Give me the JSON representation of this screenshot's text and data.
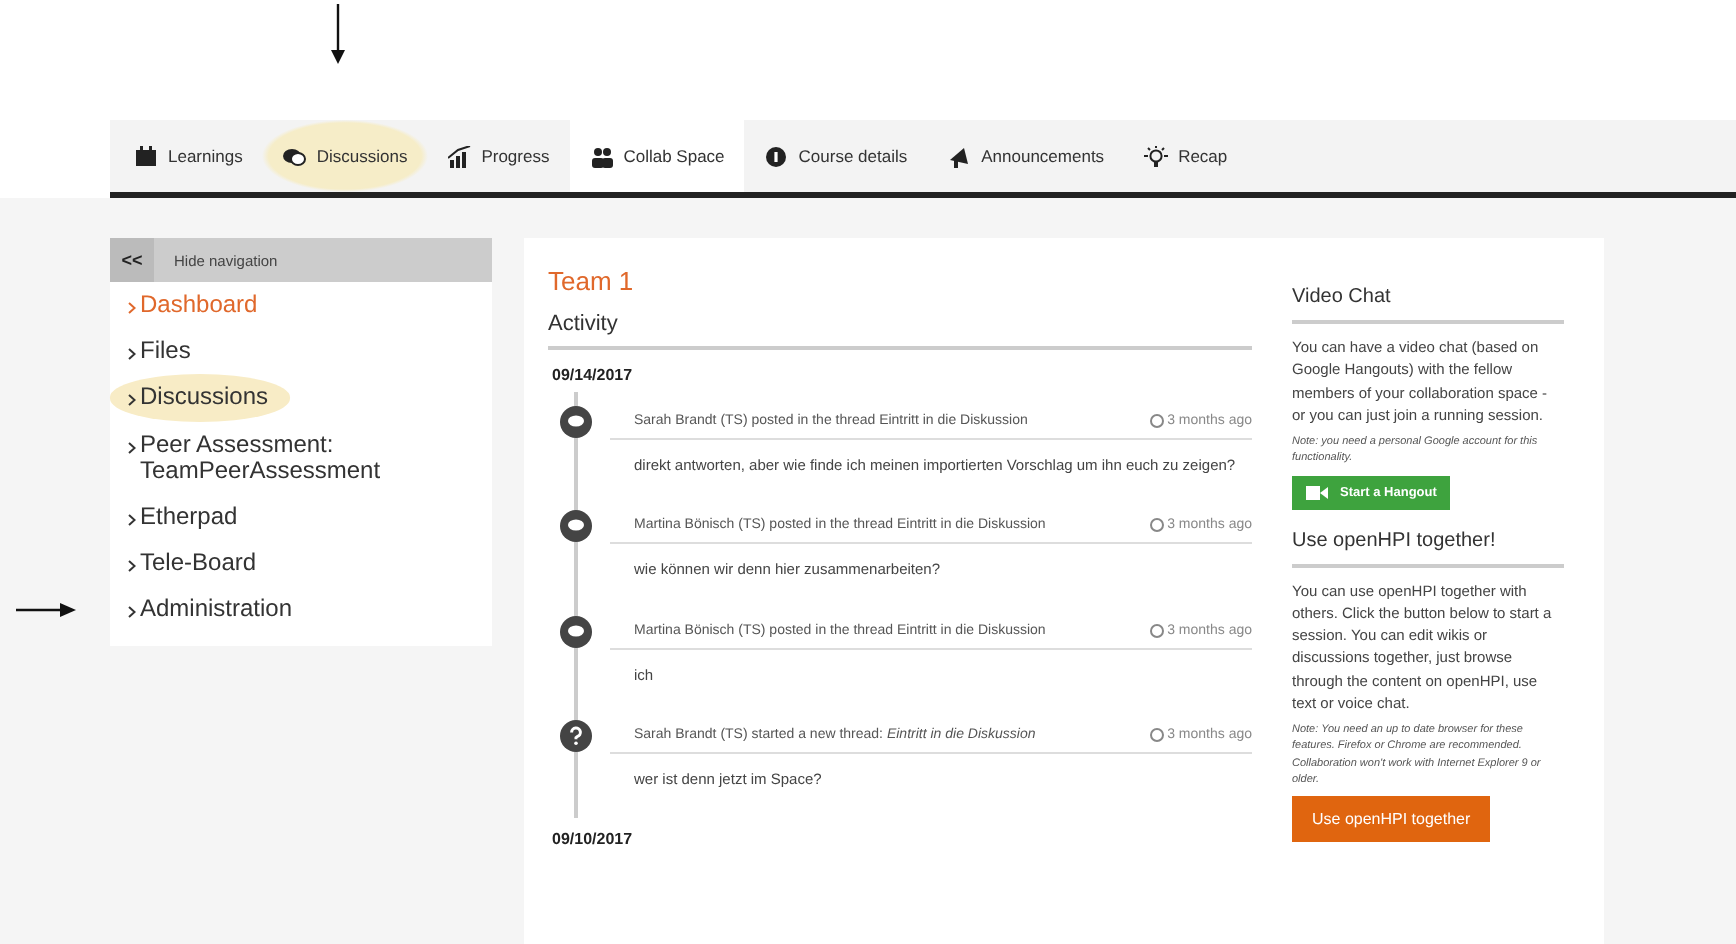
{
  "tabs": [
    {
      "label": "Learnings",
      "selected": false,
      "highlighted": false
    },
    {
      "label": "Discussions",
      "selected": false,
      "highlighted": true
    },
    {
      "label": "Progress",
      "selected": false,
      "highlighted": false
    },
    {
      "label": "Collab Space",
      "selected": true,
      "highlighted": false
    },
    {
      "label": "Course details",
      "selected": false,
      "highlighted": false
    },
    {
      "label": "Announcements",
      "selected": false,
      "highlighted": false
    },
    {
      "label": "Recap",
      "selected": false,
      "highlighted": false
    }
  ],
  "sidebar": {
    "toggle": "<<",
    "hide_label": "Hide navigation",
    "items": [
      {
        "label": "Dashboard",
        "selected": true,
        "highlighted": false
      },
      {
        "label": "Files",
        "selected": false,
        "highlighted": false
      },
      {
        "label": "Discussions",
        "selected": false,
        "highlighted": true
      },
      {
        "label": "Peer Assessment: TeamPeerAssessment",
        "selected": false,
        "highlighted": false
      },
      {
        "label": "Etherpad",
        "selected": false,
        "highlighted": false
      },
      {
        "label": "Tele-Board",
        "selected": false,
        "highlighted": false
      },
      {
        "label": "Administration",
        "selected": false,
        "highlighted": false
      }
    ]
  },
  "main": {
    "title": "Team 1",
    "section": "Activity",
    "groups": [
      {
        "date": "09/14/2017",
        "items": [
          {
            "kind": "post",
            "headline": "Sarah Brandt (TS) posted in the thread Eintritt in die Diskussion",
            "time": "3 months ago",
            "body": "direkt antworten, aber wie finde ich meinen importierten Vorschlag um ihn euch zu zeigen?"
          },
          {
            "kind": "post",
            "headline": "Martina Bönisch (TS) posted in the thread Eintritt in die Diskussion",
            "time": "3 months ago",
            "body": "wie können wir denn hier zusammenarbeiten?"
          },
          {
            "kind": "post",
            "headline": "Martina Bönisch (TS) posted in the thread Eintritt in die Diskussion",
            "time": "3 months ago",
            "body": "ich"
          },
          {
            "kind": "thread",
            "headline": "Sarah Brandt (TS) started a new thread: *Eintritt in die Diskussion*",
            "time": "3 months ago",
            "body": "wer ist denn jetzt im Space?"
          }
        ]
      },
      {
        "date": "09/10/2017"
      }
    ]
  },
  "aside": [
    {
      "title": "Video Chat",
      "text": "You can have a video chat (based on Google Hangouts) with the fellow members of your collaboration space - or you can just join a running session.",
      "note": "Note: you need a personal Google account for this functionality.",
      "button": "Start a Hangout",
      "kind": "hangout"
    },
    {
      "title": "Use openHPI together!",
      "text": "You can use openHPI together with others. Click the button below to start a session. You can edit wikis or discussions together, just browse through the content on openHPI, use text or voice chat.",
      "note": "Note: You need an up to date browser for these features. Firefox or Chrome are recommended. Collaboration won't work with Internet Explorer 9 or older.",
      "button": "Use openHPI together",
      "kind": "together"
    }
  ]
}
